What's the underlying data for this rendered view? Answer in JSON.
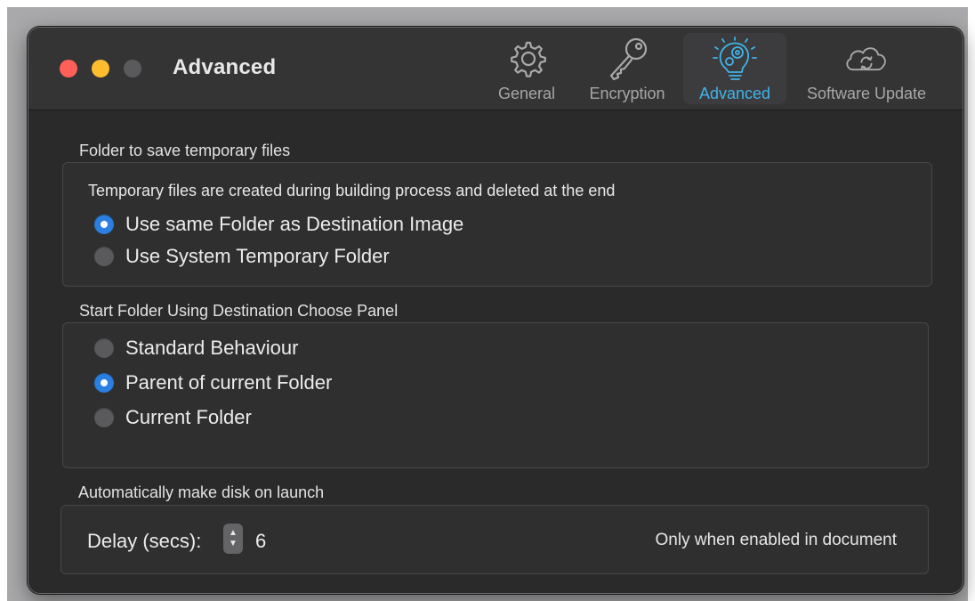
{
  "window": {
    "title": "Advanced",
    "accent_color": "#3fb4e8",
    "traffic_lights": {
      "close": "#fe5f57",
      "minimize": "#febc2e",
      "zoom": "#5a5a5c"
    }
  },
  "toolbar": {
    "tabs": [
      {
        "label": "General",
        "icon": "gear-icon",
        "active": false
      },
      {
        "label": "Encryption",
        "icon": "key-icon",
        "active": false
      },
      {
        "label": "Advanced",
        "icon": "lightbulb-gears-icon",
        "active": true
      },
      {
        "label": "Software Update",
        "icon": "cloud-sync-icon",
        "active": false
      }
    ]
  },
  "temp_folder": {
    "section_title": "Folder to save temporary files",
    "description": "Temporary files are created during building process and deleted at the end",
    "options": [
      {
        "label": "Use same Folder as Destination Image",
        "selected": true
      },
      {
        "label": "Use System Temporary Folder",
        "selected": false
      }
    ]
  },
  "start_folder": {
    "section_title": "Start Folder Using Destination Choose Panel",
    "options": [
      {
        "label": "Standard Behaviour",
        "selected": false
      },
      {
        "label": "Parent of current Folder",
        "selected": true
      },
      {
        "label": "Current Folder",
        "selected": false
      }
    ]
  },
  "auto_disk": {
    "section_title": "Automatically make disk on launch",
    "delay_label": "Delay (secs):",
    "delay_value": "6",
    "note": "Only when enabled in document"
  }
}
